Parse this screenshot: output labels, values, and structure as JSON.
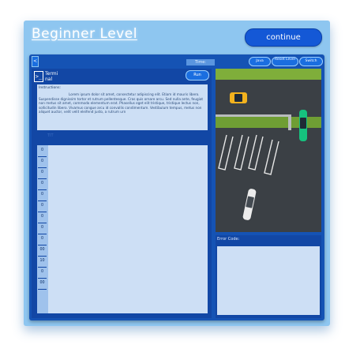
{
  "header": {
    "title": "Beginner Level",
    "continue_label": "continue"
  },
  "toolbar": {
    "collapse_label": "<",
    "time_label": "Time:",
    "java_label": "Java",
    "reset_label": "Reset Level",
    "switch_label": "Switch"
  },
  "terminal": {
    "icon_glyph": ">_",
    "label": "Termi nal",
    "run_label": "Run"
  },
  "instructions": {
    "heading": "Instructions:",
    "body": "Lorem ipsum dolor sit amet, consectetur adipiscing elit. Etiam id mauris libero. Suspendisse dignissim tortor et rutrum pellentesque. Cras quis ornare arcu. Sed nulla ante, feugiat non metus sit amet, commodo elementum erat. Phasellus eget elit tristique, tristique lectus non, sollicitudin libero. Vivamus congue arcu id convallis condimentum. Vestibulum tempus, metus non aliquet auctor, velit velit eleifend justo, a rutrum urn"
  },
  "editor": {
    "faint_text": "TIT",
    "line_numbers": [
      "0",
      "0",
      "0",
      "0",
      "0",
      "0",
      "0",
      "0",
      "0",
      "00",
      "10",
      "0",
      "00"
    ]
  },
  "game": {
    "cars": [
      {
        "name": "yellow-car",
        "color": "#f2b21e"
      },
      {
        "name": "green-car",
        "color": "#16c27e"
      },
      {
        "name": "white-car",
        "color": "#ececec"
      }
    ],
    "grass_color": "#7fae3a",
    "asphalt_color": "#3b4045"
  },
  "error": {
    "label": "Error Code:",
    "text": ""
  },
  "colors": {
    "panel_blue": "#1553b4",
    "accent_blue": "#1458d6",
    "light_panel": "#cddff5",
    "sky": "#8ec6f0"
  }
}
